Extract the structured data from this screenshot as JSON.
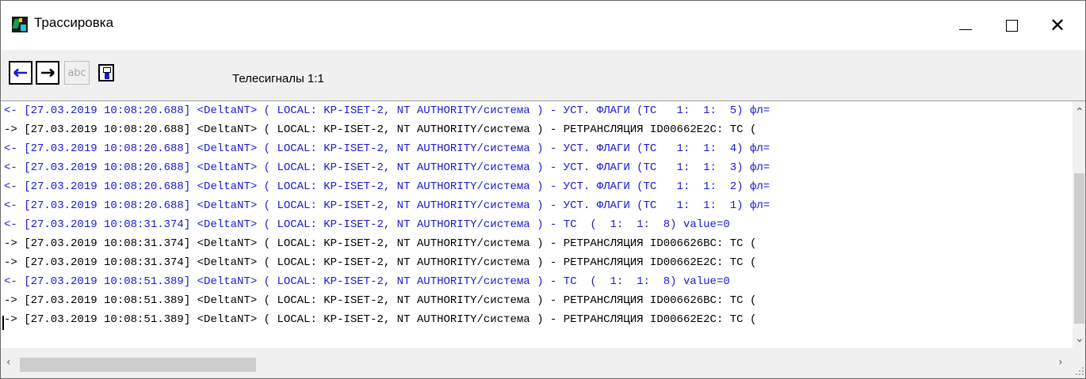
{
  "window": {
    "title": "Трассировка",
    "close_glyph": "✕"
  },
  "toolbar": {
    "back_icon": "arrow-left-icon",
    "forward_icon": "arrow-right-icon",
    "abc_label": "abc",
    "save_icon": "save-to-file-icon",
    "channel_label": "Телесигналы 1:1"
  },
  "log": {
    "colors": {
      "outgoing": "#1a1ad2",
      "incoming": "#000000"
    },
    "lines": [
      {
        "dir": "out",
        "text": "<- [27.03.2019 10:08:20.688] <DeltaNT> ( LOCAL: KP-ISET-2, NT AUTHORITY/система ) - УСТ. ФЛАГИ (ТС   1:  1:  5) фл="
      },
      {
        "dir": "in",
        "text": "-> [27.03.2019 10:08:20.688] <DeltaNT> ( LOCAL: KP-ISET-2, NT AUTHORITY/система ) - РЕТРАНСЛЯЦИЯ ID00662E2C: ТС ("
      },
      {
        "dir": "out",
        "text": "<- [27.03.2019 10:08:20.688] <DeltaNT> ( LOCAL: KP-ISET-2, NT AUTHORITY/система ) - УСТ. ФЛАГИ (ТС   1:  1:  4) фл="
      },
      {
        "dir": "out",
        "text": "<- [27.03.2019 10:08:20.688] <DeltaNT> ( LOCAL: KP-ISET-2, NT AUTHORITY/система ) - УСТ. ФЛАГИ (ТС   1:  1:  3) фл="
      },
      {
        "dir": "out",
        "text": "<- [27.03.2019 10:08:20.688] <DeltaNT> ( LOCAL: KP-ISET-2, NT AUTHORITY/система ) - УСТ. ФЛАГИ (ТС   1:  1:  2) фл="
      },
      {
        "dir": "out",
        "text": "<- [27.03.2019 10:08:20.688] <DeltaNT> ( LOCAL: KP-ISET-2, NT AUTHORITY/система ) - УСТ. ФЛАГИ (ТС   1:  1:  1) фл="
      },
      {
        "dir": "out",
        "text": "<- [27.03.2019 10:08:31.374] <DeltaNT> ( LOCAL: KP-ISET-2, NT AUTHORITY/система ) - ТС  (  1:  1:  8) value=0"
      },
      {
        "dir": "in",
        "text": "-> [27.03.2019 10:08:31.374] <DeltaNT> ( LOCAL: KP-ISET-2, NT AUTHORITY/система ) - РЕТРАНСЛЯЦИЯ ID006626BC: ТС ("
      },
      {
        "dir": "in",
        "text": "-> [27.03.2019 10:08:31.374] <DeltaNT> ( LOCAL: KP-ISET-2, NT AUTHORITY/система ) - РЕТРАНСЛЯЦИЯ ID00662E2C: ТС ("
      },
      {
        "dir": "out",
        "text": "<- [27.03.2019 10:08:51.389] <DeltaNT> ( LOCAL: KP-ISET-2, NT AUTHORITY/система ) - ТС  (  1:  1:  8) value=0"
      },
      {
        "dir": "in",
        "text": "-> [27.03.2019 10:08:51.389] <DeltaNT> ( LOCAL: KP-ISET-2, NT AUTHORITY/система ) - РЕТРАНСЛЯЦИЯ ID006626BC: ТС ("
      },
      {
        "dir": "in",
        "text": "-> [27.03.2019 10:08:51.389] <DeltaNT> ( LOCAL: KP-ISET-2, NT AUTHORITY/система ) - РЕТРАНСЛЯЦИЯ ID00662E2C: ТС ("
      }
    ]
  }
}
